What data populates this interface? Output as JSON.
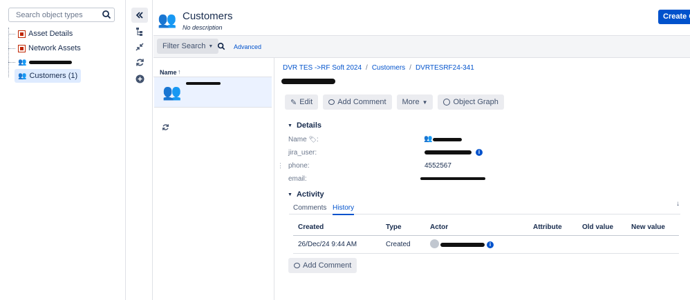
{
  "search": {
    "placeholder": "Search object types"
  },
  "tree": {
    "items": [
      {
        "label": "Asset Details"
      },
      {
        "label": "Network Assets"
      },
      {
        "label": ""
      },
      {
        "label": "Customers (1)"
      }
    ]
  },
  "header": {
    "title": "Customers",
    "subtitle": "No description",
    "create_label": "Create O"
  },
  "toolbar": {
    "filter_label": "Filter Search",
    "advanced_label": "Advanced"
  },
  "list": {
    "column_header": "Name"
  },
  "detail": {
    "breadcrumb": [
      "DVR TES ->RF Soft 2024",
      "Customers",
      "DVRTESRF24-341"
    ],
    "breadcrumb_sep": "/",
    "actions": {
      "edit": "Edit",
      "add_comment": "Add Comment",
      "more": "More",
      "graph": "Object Graph"
    },
    "details_title": "Details",
    "fields": [
      {
        "label": "Name",
        "value": ""
      },
      {
        "label": "jira_user:",
        "value": ""
      },
      {
        "label": "phone:",
        "value": "4552567"
      },
      {
        "label": "email:",
        "value": ""
      }
    ],
    "activity_title": "Activity",
    "tabs": [
      "Comments",
      "History"
    ],
    "history": {
      "columns": [
        "Created",
        "Type",
        "Actor",
        "Attribute",
        "Old value",
        "New value"
      ],
      "rows": [
        {
          "created": "26/Dec/24 9:44 AM",
          "type": "Created",
          "actor": ""
        }
      ]
    },
    "bottom_comment": "Add Comment"
  },
  "colors": {
    "accent": "#0052cc",
    "selected": "#deebff"
  }
}
